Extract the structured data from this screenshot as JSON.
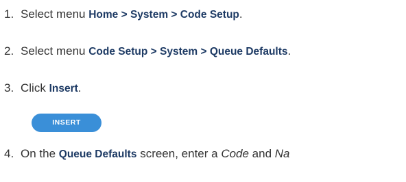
{
  "steps": [
    {
      "number": "1.",
      "text": "Select menu ",
      "path": "Home > System > Code Setup",
      "end": "."
    },
    {
      "number": "2.",
      "text": "Select menu ",
      "path": "Code Setup > System > Queue Defaults",
      "end": "."
    },
    {
      "number": "3.",
      "text": "Click ",
      "path": "Insert",
      "end": "."
    },
    {
      "number": "4.",
      "text": "On the ",
      "screen": "Queue Defaults",
      "middle": " screen, enter a ",
      "field1": "Code",
      "and": " and ",
      "field2": "Na"
    }
  ],
  "insert_button": {
    "label": "INSERT",
    "color": "#3a8fd8"
  },
  "colors": {
    "body_text": "#333333",
    "keyword_text": "#1d3a64"
  }
}
